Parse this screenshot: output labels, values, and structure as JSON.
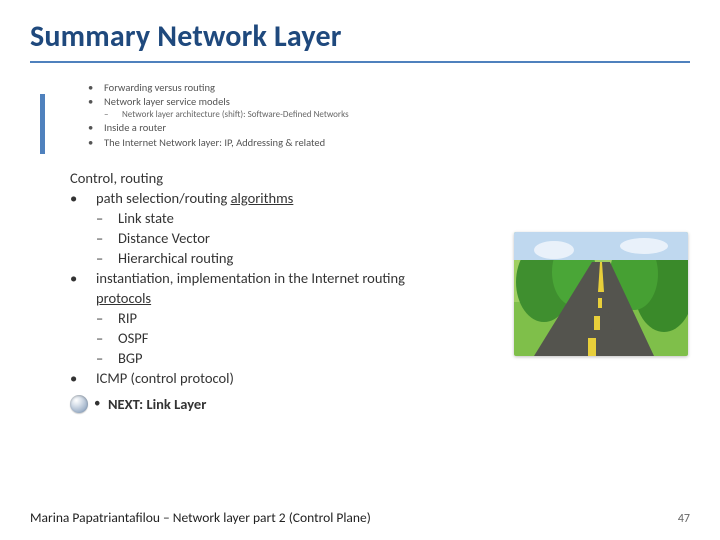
{
  "title": "Summary Network Layer",
  "small_list": {
    "i0": "Forwarding versus routing",
    "i1": "Network layer service models",
    "i1_sub": "Network layer architecture (shift): Software-Defined Networks",
    "i2": "Inside a router",
    "i3": "The Internet Network layer: IP, Addressing & related"
  },
  "main": {
    "heading": "Control, routing",
    "p0_a": "path selection/routing ",
    "p0_b": "algorithms",
    "p0_s0": "Link state",
    "p0_s1": "Distance Vector",
    "p0_s2": "Hierarchical routing",
    "p1_a": "instantiation, implementation in the Internet routing ",
    "p1_b": "protocols",
    "p1_s0": "RIP",
    "p1_s1": "OSPF",
    "p1_s2": "BGP",
    "p2": "ICMP (control protocol)"
  },
  "next": {
    "bullet": "•",
    "text": "NEXT: Link Layer"
  },
  "bullets": {
    "dot": "•",
    "dash": "–"
  },
  "footer": {
    "author": "Marina Papatriantafilou – Network layer part 2 (Control Plane)",
    "page": "47"
  },
  "image": {
    "alt": "road-through-forest-photo"
  }
}
